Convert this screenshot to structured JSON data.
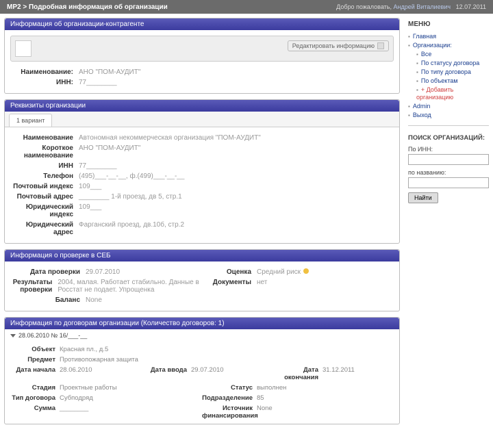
{
  "topbar": {
    "breadcrumb": "MP2 > Подробная информация об организации",
    "welcome_prefix": "Добро пожаловать,",
    "username": "Андрей Виталиевич",
    "date": "12.07.2011"
  },
  "panel_org": {
    "title": "Информация об организации-контрагенте",
    "edit_label": "Редактировать информацию",
    "name_label": "Наименование:",
    "name_value": "АНО \"ПОМ-АУДИТ\"",
    "inn_label": "ИНН:",
    "inn_value": "77________"
  },
  "panel_req": {
    "title": "Реквизиты организации",
    "tab": "1 вариант",
    "rows": [
      {
        "label": "Наименование",
        "value": "Автономная некоммерческая организация \"ПОМ-АУДИТ\""
      },
      {
        "label": "Короткое наименование",
        "value": "АНО \"ПОМ-АУДИТ\""
      },
      {
        "label": "ИНН",
        "value": "77________"
      },
      {
        "label": "Телефон",
        "value": "(495)___-__-__, ф.(499)___-__-__"
      },
      {
        "label": "Почтовый индекс",
        "value": "109___"
      },
      {
        "label": "Почтовый адрес",
        "value": "________ 1-й проезд, дв 5, стр.1"
      },
      {
        "label": "Юридический индекс",
        "value": "109___"
      },
      {
        "label": "Юридический адрес",
        "value": "Фарганский проезд, дв.10б, стр.2"
      }
    ]
  },
  "panel_seb": {
    "title": "Информация о проверке в СЕБ",
    "left": [
      {
        "label": "Дата проверки",
        "value": "29.07.2010"
      },
      {
        "label": "Результаты проверки",
        "value": "2004, малая. Работает стабильно. Данные в Росстат не подает. Упрощенка"
      },
      {
        "label": "Баланс",
        "value": "None"
      }
    ],
    "right": [
      {
        "label": "Оценка",
        "value": "Средний риск"
      },
      {
        "label": "Документы",
        "value": "нет"
      }
    ]
  },
  "panel_contracts": {
    "title": "Информация по договорам организации (Количество договоров: 1)",
    "header": "28.06.2010 № 16/___-__",
    "rows": [
      [
        {
          "label": "Объект",
          "value": "Красная пл., д.5"
        }
      ],
      [
        {
          "label": "Предмет",
          "value": "Противопожарная защита"
        }
      ],
      [
        {
          "label": "Дата начала",
          "value": "28.06.2010"
        },
        {
          "label": "Дата ввода",
          "value": "29.07.2010"
        },
        {
          "label": "Дата окончания",
          "value": "31.12.2011"
        }
      ],
      [
        {
          "label": "Стадия",
          "value": "Проектные работы"
        },
        {
          "label": "Статус",
          "value": "выполнен"
        }
      ],
      [
        {
          "label": "Тип договора",
          "value": "Субподряд"
        },
        {
          "label": "Подразделение",
          "value": "85"
        }
      ],
      [
        {
          "label": "Сумма",
          "value": "________"
        },
        {
          "label": "Источник финансирования",
          "value": "None"
        }
      ]
    ]
  },
  "menu": {
    "title": "МЕНЮ",
    "items": {
      "main": "Главная",
      "org": "Организации:",
      "all": "Все",
      "by_status": "По статусу договора",
      "by_type": "По типу договора",
      "by_object": "По объектам",
      "add": "+ Добавить организацию",
      "admin": "Admin",
      "exit": "Выход"
    }
  },
  "search": {
    "title": "ПОИСК ОРГАНИЗАЦИЙ:",
    "by_inn": "По ИНН:",
    "by_name": "по названию:",
    "btn": "Найти"
  }
}
